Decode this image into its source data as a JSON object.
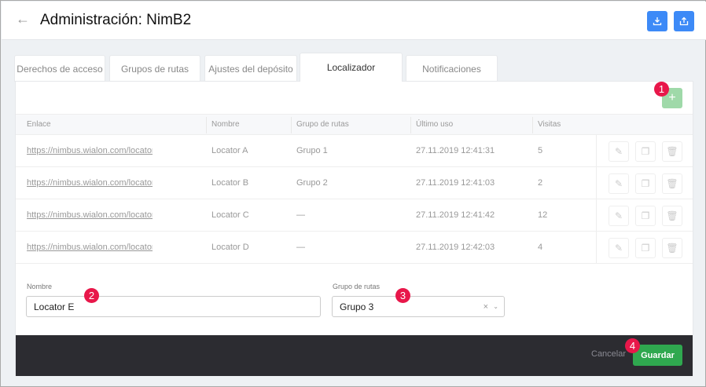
{
  "header": {
    "title": "Administración: NimB2",
    "back_icon": "←",
    "download_icon": "download-icon",
    "upload_icon": "upload-icon"
  },
  "tabs": [
    {
      "label": "Derechos de acceso"
    },
    {
      "label": "Grupos de rutas"
    },
    {
      "label": "Ajustes del depósito"
    },
    {
      "label": "Localizador"
    },
    {
      "label": "Notificaciones"
    }
  ],
  "active_tab": "Localizador",
  "add_label": "+",
  "badges": [
    "1",
    "2",
    "3",
    "4"
  ],
  "table": {
    "columns": [
      "Enlace",
      "Nombre",
      "Grupo de rutas",
      "Último uso",
      "Visitas"
    ],
    "rows": [
      {
        "link": "https://nimbus.wialon.com/locator/",
        "name": "Locator A",
        "group": "Grupo 1",
        "last_used": "27.11.2019 12:41:31",
        "visits": "5"
      },
      {
        "link": "https://nimbus.wialon.com/locator/",
        "name": "Locator B",
        "group": "Grupo 2",
        "last_used": "27.11.2019 12:41:03",
        "visits": "2"
      },
      {
        "link": "https://nimbus.wialon.com/locator/",
        "name": "Locator C",
        "group": "—",
        "last_used": "27.11.2019 12:41:42",
        "visits": "12"
      },
      {
        "link": "https://nimbus.wialon.com/locator/",
        "name": "Locator D",
        "group": "—",
        "last_used": "27.11.2019 12:42:03",
        "visits": "4"
      }
    ]
  },
  "form": {
    "name_label": "Nombre",
    "name_value": "Locator E",
    "group_label": "Grupo de rutas",
    "group_value": "Grupo 3"
  },
  "footer": {
    "cancel": "Cancelar",
    "save": "Guardar"
  },
  "colors": {
    "primary": "#3d8af7",
    "success": "#2fa84f",
    "badge": "#e8174a",
    "footer": "#2c2c31"
  }
}
